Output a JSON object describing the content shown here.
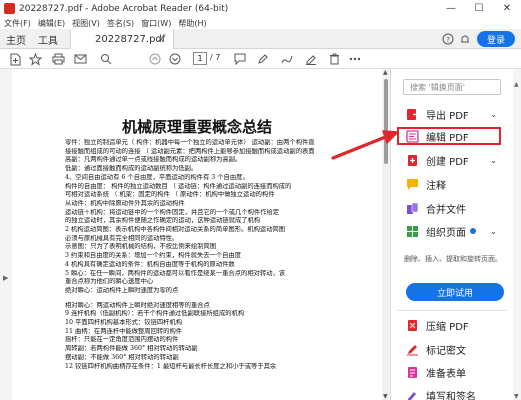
{
  "window": {
    "title": "20228727.pdf - Adobe Acrobat Reader (64-bit)",
    "minimize": "—",
    "maximize": "☐",
    "close": "✕"
  },
  "menu": [
    "文件(F)",
    "编辑(E)",
    "视图(V)",
    "签名(S)",
    "窗口(W)",
    "帮助(H)"
  ],
  "tabs": {
    "home": "主页",
    "tools": "工具",
    "document": "20228727.pdf",
    "close": "×",
    "signin": "登录"
  },
  "toolbar": {
    "current_page": "1",
    "total_pages": "/ 7"
  },
  "document": {
    "title": "机械原理重要概念总结",
    "lines": [
      "零件：独立的制造单元（ 构件：机器中每一个独立的运动单元体）  运动副：由两个构件直",
      "接接触而组成的可动的连接  （ 运动副元素：把两构件上能够参加接触而构成运动副的表面",
      "高副：凡两构件通过单一点或线接触而构成的运动副称为高副。",
      "低副：通过面接触而构成的运动副统称为低副。",
      "4、空间自由运动有 6 个自由度，平面运动的构件有 3 个自由度。",
      "构件的自由度：  构件的独立运动数目   （  运动链：构件通过运动副的连接而构成的",
      "可相对运动系统  （  机架：固定的构件 （  原动件：机构中做独立运动的构件",
      "  从动件：机构中除原动件外其余的运动构件",
      "  运动链＋机构：将运动链中的一个构件固定，并且它的一个或几个构件作给定",
      "的独立运动时，其余构件便随之作确定的运动，这种运动链就成了机构",
      "2 机构运动简图：表示机构中各构件间相对运动关系的简单图形。机构运动简图",
      "必须与原机械具有完全相同的运动特性。",
      "    示意图：只为了表明机械的结构，不按比例来绘制简图",
      "3 约束和自由度的关系：增加一个约束，构件就失去一个自由度",
      "4 机构具有确定运动的条件：机构自由度等于机构的原动件数",
      "5 瞬心：在任一瞬间，两构件的运动都可以看作是绕某一重合点的相对转动，该",
      "重合点称为他们的瞬心速度中心",
      "    绝对瞬心：运动构件上瞬时速度为零的点",
      "",
      "相对瞬心：两运动构件上瞬时绝对速度相等的重合点",
      "9 连杆机构（低副机构）：若干个构件通过低副联接所组成的机构",
      "10 平面四杆机构基本形式：铰链四杆机构",
      "11 曲柄：在两连杆中能做整周回转的构件",
      "    摇杆：只能在一定角度范围内摆动的构件",
      "    周转副：若两构件能做 360° 相对转动的转动副",
      "    摆动副：不能做 360° 相对转动的转动副",
      "12 铰链四杆机构曲柄存在条件：1 最短杆与最长杆长度之和小于或等于其余"
    ]
  },
  "right_pane": {
    "search_placeholder": "搜索 '辑换页面'",
    "tools": [
      {
        "label": "导出 PDF",
        "icon": "export-pdf-icon",
        "chevron": "⌄"
      },
      {
        "label": "编辑 PDF",
        "icon": "edit-pdf-icon"
      },
      {
        "label": "创建 PDF",
        "icon": "create-pdf-icon",
        "chevron": "⌄"
      },
      {
        "label": "注释",
        "icon": "comment-icon"
      },
      {
        "label": "合并文件",
        "icon": "combine-files-icon"
      },
      {
        "label": "组织页面",
        "icon": "organize-pages-icon",
        "chevron": "⌄"
      }
    ],
    "description": "删除、插入、提取和旋转页面。",
    "try_button": "立即试用",
    "more_tools": [
      {
        "label": "压缩 PDF",
        "icon": "compress-pdf-icon"
      },
      {
        "label": "标记密文",
        "icon": "redact-icon"
      },
      {
        "label": "准备表单",
        "icon": "prepare-form-icon"
      },
      {
        "label": "填写和签名",
        "icon": "fill-sign-icon"
      }
    ]
  },
  "colors": {
    "accent_blue": "#1473e6",
    "highlight_red": "#e0262d",
    "acrobat_red": "#d62b1f"
  }
}
